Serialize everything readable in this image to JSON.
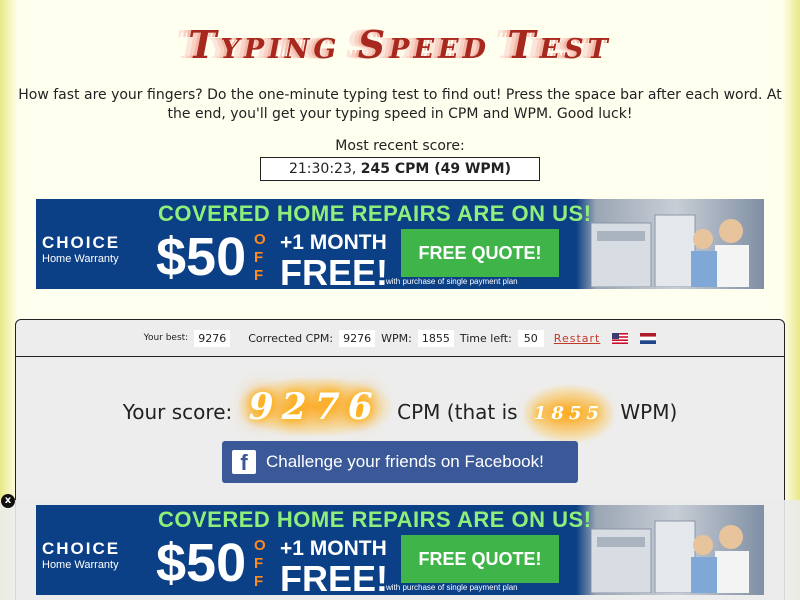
{
  "header": {
    "title": "Typing Speed Test"
  },
  "intro": "How fast are your fingers? Do the one-minute typing test to find out! Press the space bar after each word. At the end, you'll get your typing speed in CPM and WPM. Good luck!",
  "recent": {
    "label": "Most recent score:",
    "time": "21:30:23,",
    "score": "245 CPM (49 WPM)"
  },
  "ad": {
    "headline": "COVERED HOME REPAIRS ARE ON US!",
    "brand": "CHOICE",
    "brand_sub": "Home Warranty",
    "price": "$50",
    "off": "OFF",
    "month_line1": "+1 MONTH",
    "month_line2": "FREE!",
    "cta": "FREE QUOTE!",
    "fine_print": "with purchase of single payment plan"
  },
  "stats": {
    "best_label": "Your best:",
    "best_value": "9276",
    "cpm_label": "Corrected CPM:",
    "cpm_value": "9276",
    "wpm_label": "WPM:",
    "wpm_value": "1855",
    "time_label": "Time left:",
    "time_value": "50",
    "restart_label": "Restart"
  },
  "result": {
    "prefix": "Your score:",
    "cpm": "9276",
    "middle": "CPM (that is",
    "wpm": "1855",
    "suffix": "WPM)"
  },
  "facebook": {
    "label": "Challenge your friends on Facebook!"
  },
  "close_ad": {
    "label": "x"
  }
}
